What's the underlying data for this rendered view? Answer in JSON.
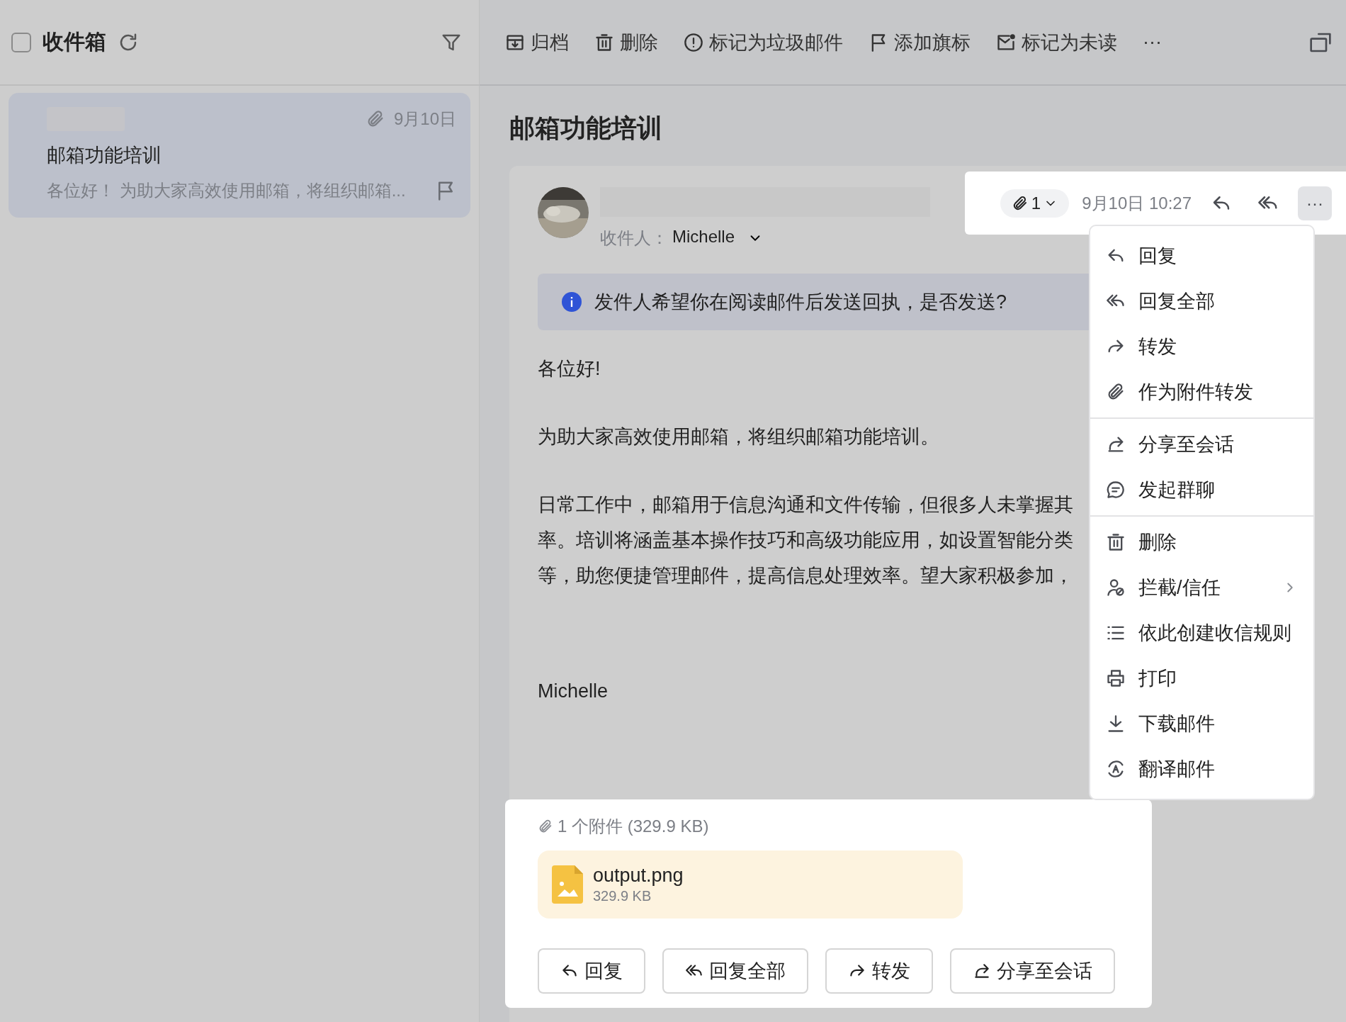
{
  "sidebar": {
    "select_all_checked": false,
    "title": "收件箱",
    "mails": [
      {
        "date": "9月10日",
        "subject": "邮箱功能培训",
        "preview": "各位好！ 为助大家高效使用邮箱，将组织邮箱...",
        "selected": true,
        "has_attachment": true,
        "flagged": false
      }
    ]
  },
  "toolbar": {
    "actions": [
      "归档",
      "删除",
      "标记为垃圾邮件",
      "添加旗标",
      "标记为未读"
    ],
    "more": "···"
  },
  "mail": {
    "subject": "邮箱功能培训",
    "recipient_label": "收件人：",
    "recipient": "Michelle",
    "attachment_count": "1",
    "datetime": "9月10日 10:27",
    "more": "···",
    "notice": "发件人希望你在阅读邮件后发送回执，是否发送?",
    "body": [
      [
        "各位好!"
      ],
      [
        "为助大家高效使用邮箱，将组织邮箱功能培训。"
      ],
      [
        "日常工作中，邮箱用于信息沟通和文件传输，但很多人未掌握其",
        "率。培训将涵盖基本操作技巧和高级功能应用，如设置智能分类",
        "等，助您便捷管理邮件，提高信息处理效率。望大家积极参加，"
      ]
    ],
    "signature": "Michelle",
    "attachments_summary": "1 个附件 (329.9 KB)",
    "attachments": [
      {
        "name": "output.png",
        "size": "329.9 KB"
      }
    ],
    "actions": [
      "回复",
      "回复全部",
      "转发",
      "分享至会话"
    ]
  },
  "menu": {
    "groups": [
      [
        {
          "label": "回复",
          "submenu": false
        },
        {
          "label": "回复全部",
          "submenu": false
        },
        {
          "label": "转发",
          "submenu": false
        },
        {
          "label": "作为附件转发",
          "submenu": false
        }
      ],
      [
        {
          "label": "分享至会话",
          "submenu": false
        },
        {
          "label": "发起群聊",
          "submenu": false
        }
      ],
      [
        {
          "label": "删除",
          "submenu": false
        },
        {
          "label": "拦截/信任",
          "submenu": true
        },
        {
          "label": "依此创建收信规则",
          "submenu": false
        },
        {
          "label": "打印",
          "submenu": false
        },
        {
          "label": "下载邮件",
          "submenu": false
        },
        {
          "label": "翻译邮件",
          "submenu": false
        }
      ]
    ]
  }
}
